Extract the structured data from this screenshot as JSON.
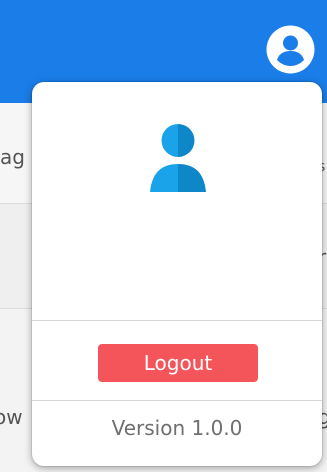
{
  "header": {
    "account_icon": "user-circle-icon",
    "color": "#1a7de8"
  },
  "background_fragments": {
    "left_row1": "ag",
    "right_row1_top": "i",
    "right_row1_bottom": "s",
    "right_row2": "r",
    "left_row3": "ow",
    "right_row3": "g"
  },
  "menu": {
    "avatar_icon": "user-icon",
    "avatar_color": "#1aa3e8",
    "logout_label": "Logout",
    "logout_color": "#f4555a",
    "version_text": "Version 1.0.0"
  }
}
